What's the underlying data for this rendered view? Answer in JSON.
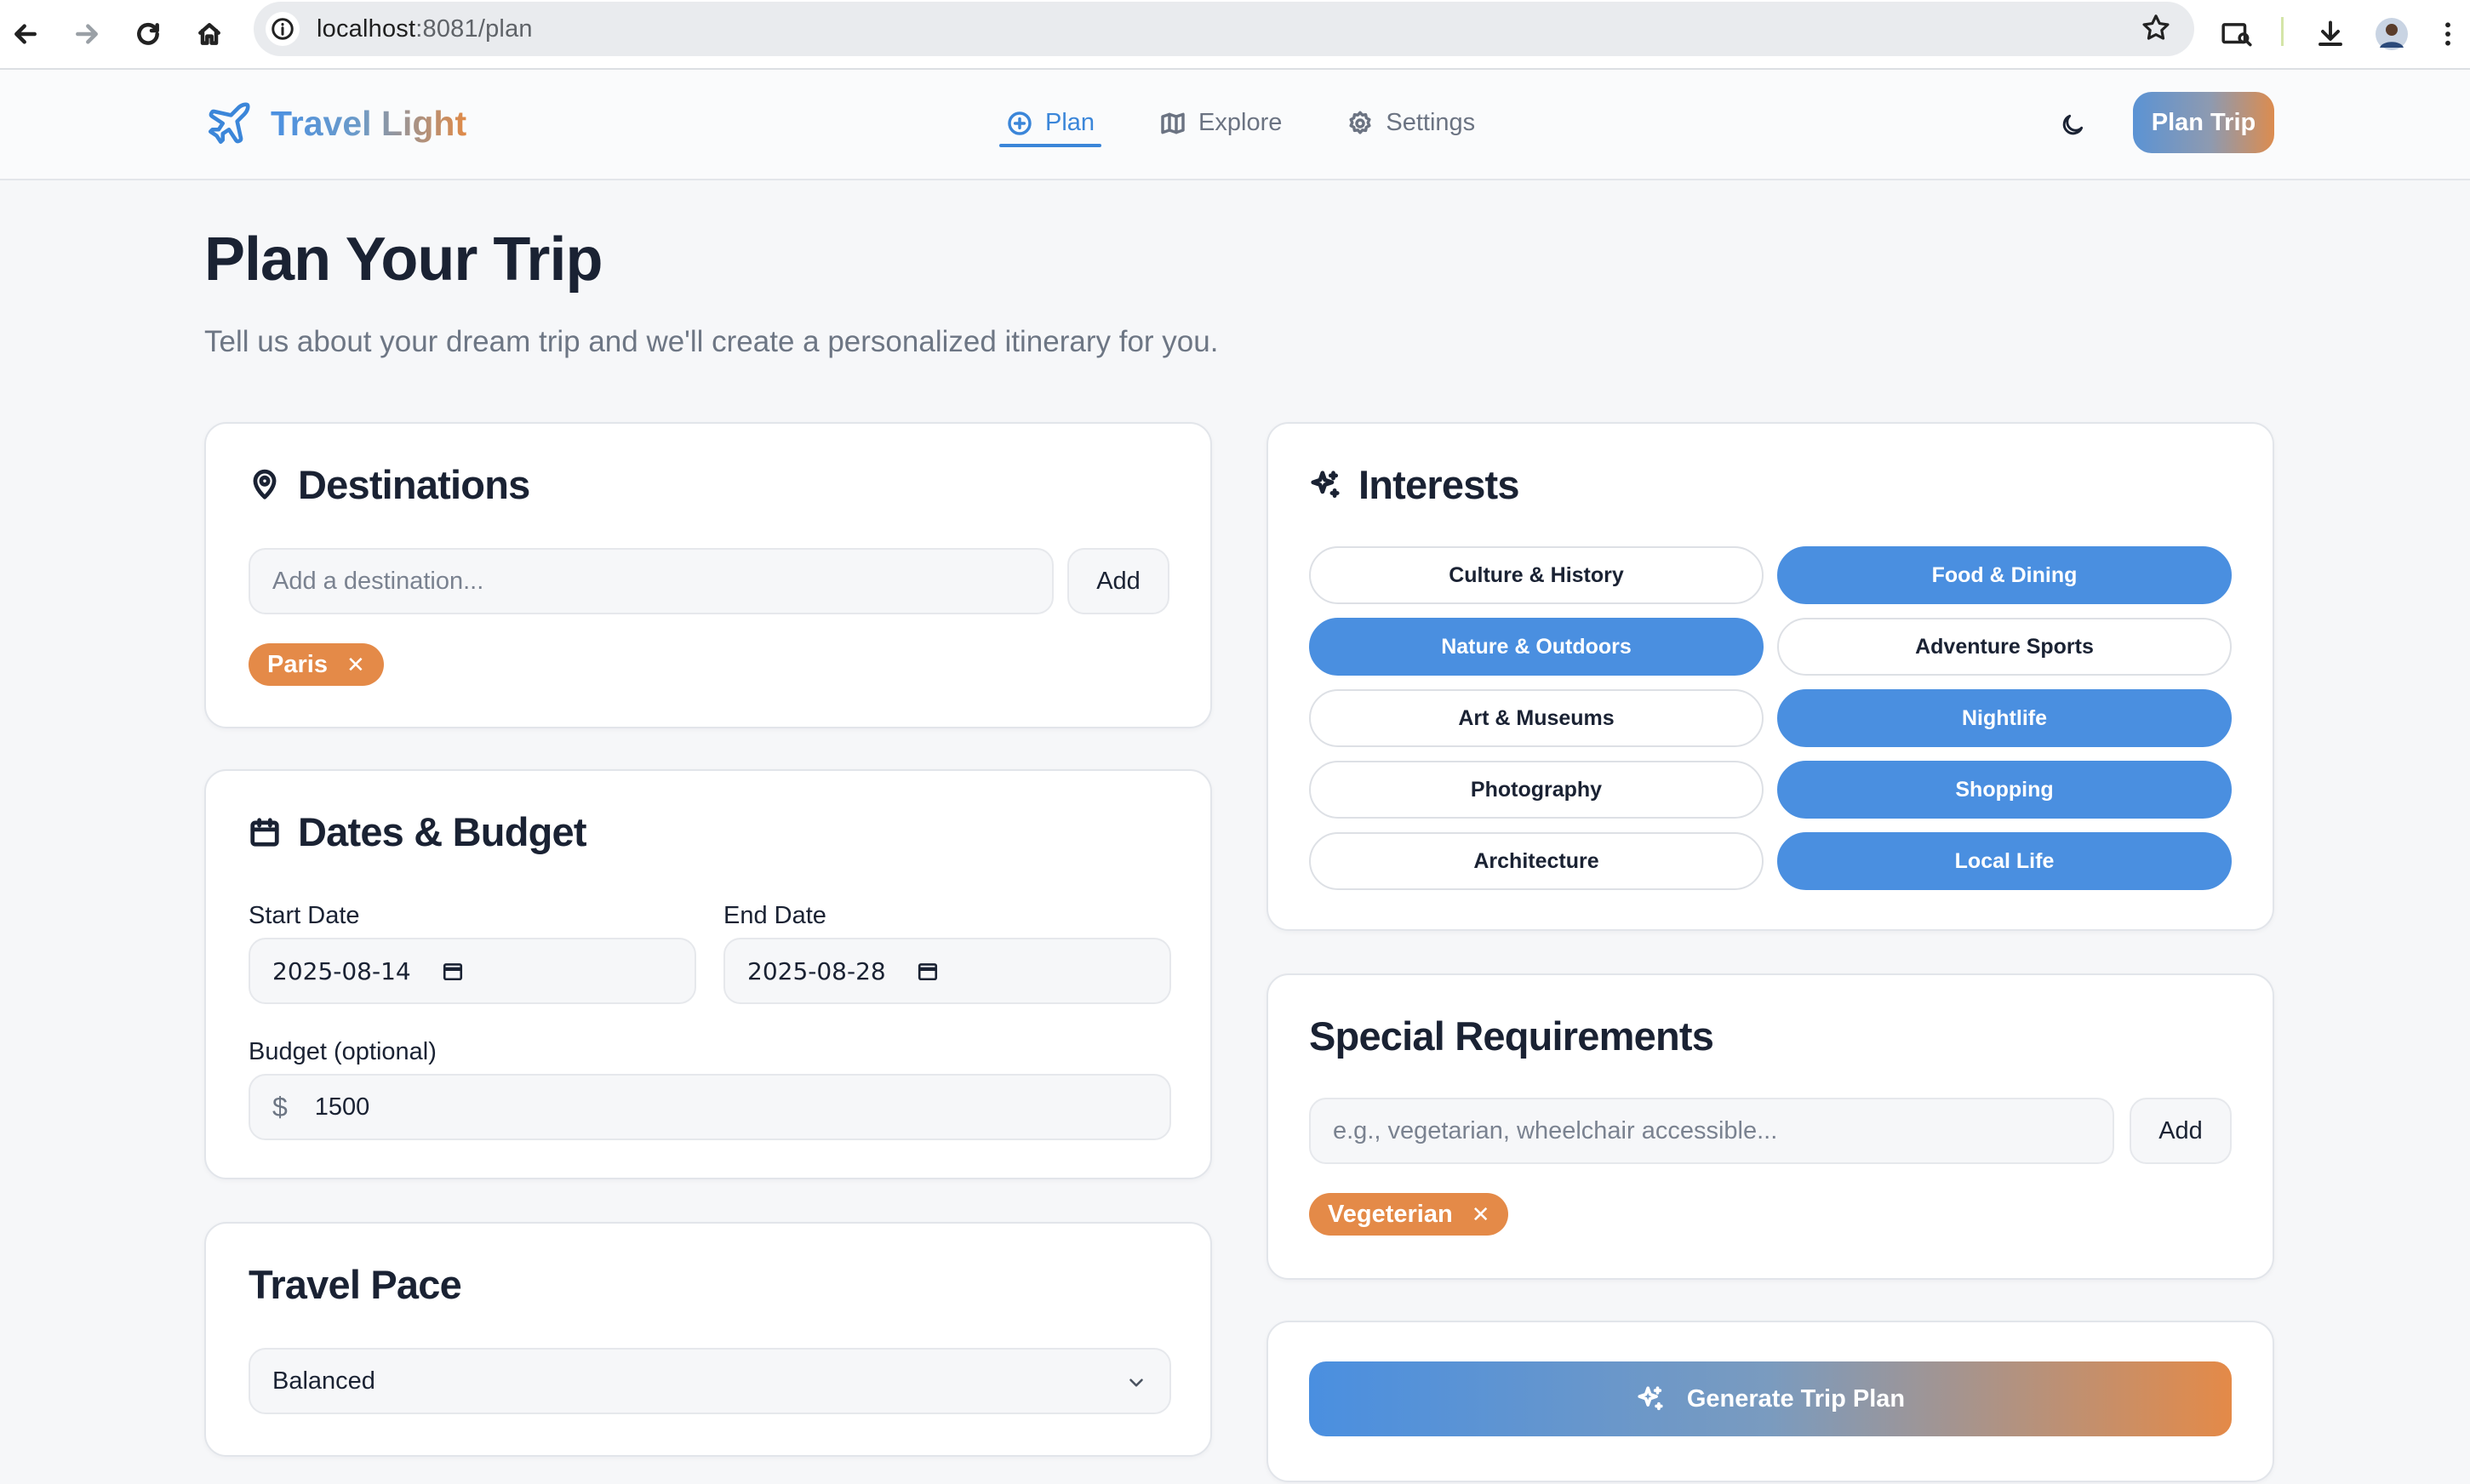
{
  "browser": {
    "url_host": "localhost",
    "url_path": ":8081/plan"
  },
  "header": {
    "brand_word1": "Travel",
    "brand_word2": "Light",
    "nav": [
      {
        "label": "Plan",
        "icon": "plus-circle-icon",
        "active": true
      },
      {
        "label": "Explore",
        "icon": "map-icon",
        "active": false
      },
      {
        "label": "Settings",
        "icon": "gear-icon",
        "active": false
      }
    ],
    "cta_label": "Plan Trip"
  },
  "page": {
    "title": "Plan Your Trip",
    "subtitle": "Tell us about your dream trip and we'll create a personalized itinerary for you."
  },
  "destinations": {
    "title": "Destinations",
    "input_placeholder": "Add a destination...",
    "add_label": "Add",
    "chips": [
      "Paris"
    ]
  },
  "dates_budget": {
    "title": "Dates & Budget",
    "start_label": "Start Date",
    "start_value": "2025-08-14",
    "end_label": "End Date",
    "end_value": "2025-08-28",
    "budget_label": "Budget (optional)",
    "currency_symbol": "$",
    "budget_value": "1500"
  },
  "travel_pace": {
    "title": "Travel Pace",
    "selected": "Balanced"
  },
  "interests": {
    "title": "Interests",
    "items": [
      {
        "label": "Culture & History",
        "selected": false
      },
      {
        "label": "Food & Dining",
        "selected": true
      },
      {
        "label": "Nature & Outdoors",
        "selected": true
      },
      {
        "label": "Adventure Sports",
        "selected": false
      },
      {
        "label": "Art & Museums",
        "selected": false
      },
      {
        "label": "Nightlife",
        "selected": true
      },
      {
        "label": "Photography",
        "selected": false
      },
      {
        "label": "Shopping",
        "selected": true
      },
      {
        "label": "Architecture",
        "selected": false
      },
      {
        "label": "Local Life",
        "selected": true
      }
    ]
  },
  "special_requirements": {
    "title": "Special Requirements",
    "input_placeholder": "e.g., vegetarian, wheelchair accessible...",
    "add_label": "Add",
    "chips": [
      "Vegeterian"
    ]
  },
  "generate": {
    "label": "Generate Trip Plan"
  },
  "colors": {
    "accent_blue": "#4a8fe0",
    "accent_orange": "#e48a48"
  }
}
